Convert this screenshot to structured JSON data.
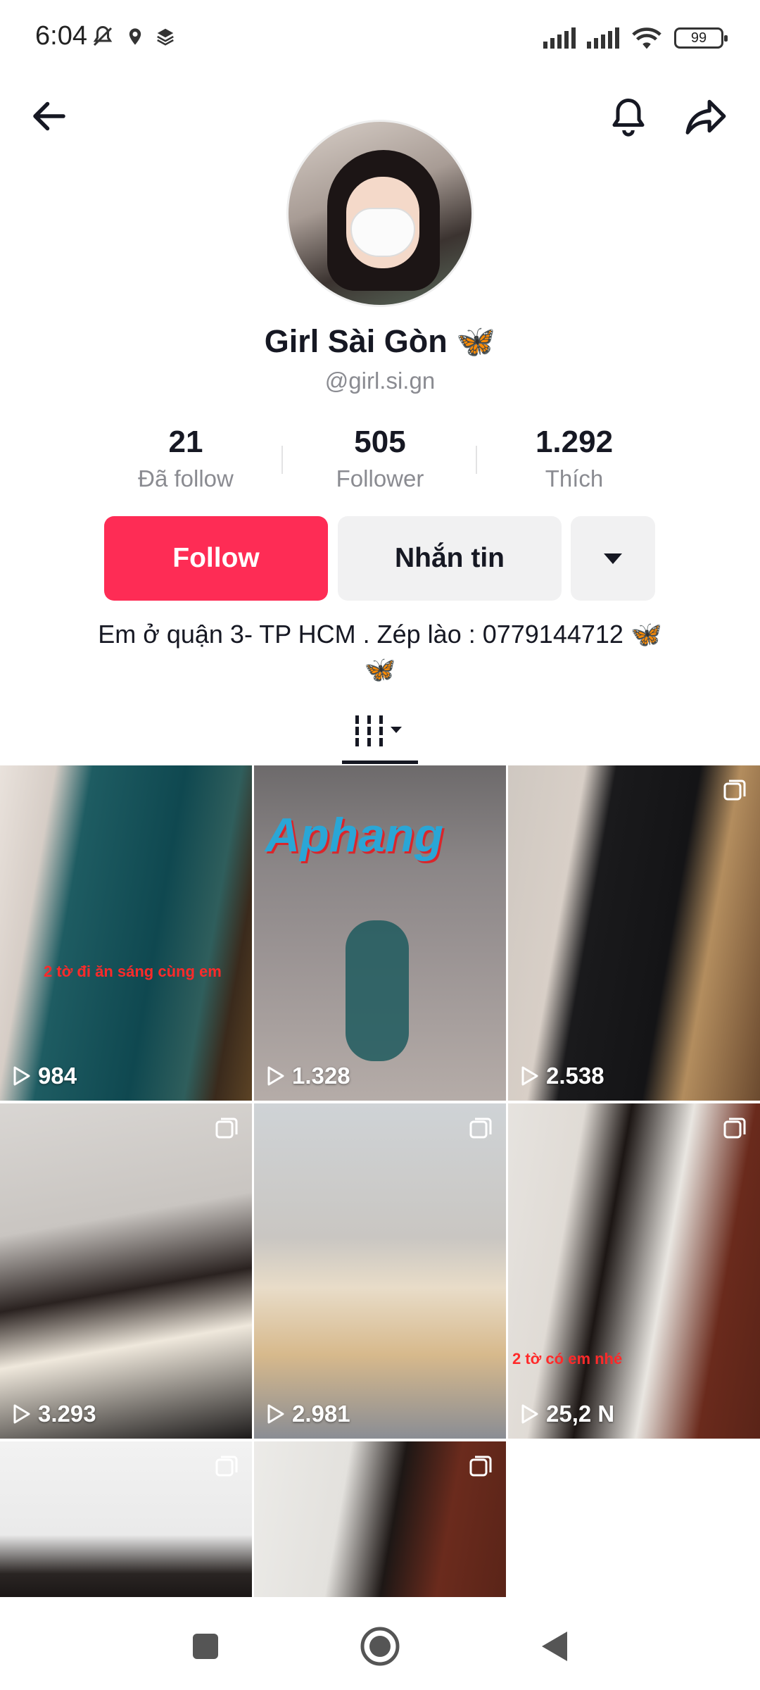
{
  "status_bar": {
    "time": "6:04",
    "battery": "99"
  },
  "profile": {
    "display_name": "Girl Sài Gòn 🦋",
    "username": "@girl.si.gn",
    "stats": [
      {
        "value": "21",
        "label": "Đã follow"
      },
      {
        "value": "505",
        "label": "Follower"
      },
      {
        "value": "1.292",
        "label": "Thích"
      }
    ],
    "follow_label": "Follow",
    "message_label": "Nhắn tin",
    "bio_line1": "Em ở quận 3- TP HCM . Zép lào : 0779144712 🦋",
    "bio_line2": "🦋"
  },
  "videos": [
    {
      "views": "984",
      "overlay": "2 tờ đi ăn sáng cùng em"
    },
    {
      "views": "1.328",
      "overlay": "Aphang"
    },
    {
      "views": "2.538",
      "overlay": ""
    },
    {
      "views": "3.293",
      "overlay": ""
    },
    {
      "views": "2.981",
      "overlay": ""
    },
    {
      "views": "25,2 N",
      "overlay": "2 tờ có em nhé"
    },
    {
      "views": "",
      "overlay": ""
    },
    {
      "views": "",
      "overlay": ""
    }
  ],
  "colors": {
    "accent": "#fe2c55",
    "secondary_button": "#f1f1f2",
    "muted_text": "#8a8b91"
  },
  "icons": [
    "back-arrow-icon",
    "bell-icon",
    "share-icon",
    "dropdown-caret-icon",
    "grid-view-icon",
    "play-icon",
    "multi-video-icon",
    "recent-apps-icon",
    "home-icon",
    "system-back-icon"
  ]
}
